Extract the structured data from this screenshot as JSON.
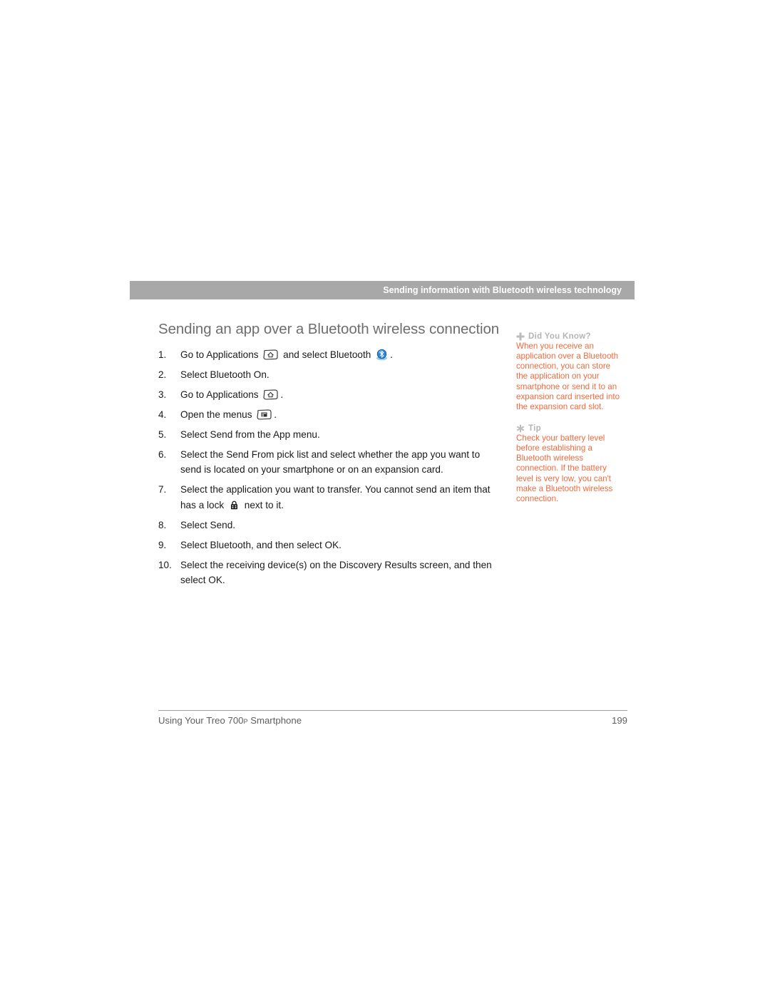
{
  "header": {
    "running_head": "Sending information with Bluetooth wireless technology",
    "banner_color": "#a8a8a8"
  },
  "main": {
    "section_heading": "Sending an app over a Bluetooth wireless connection",
    "steps": [
      {
        "number": "1.",
        "parts": [
          {
            "type": "text",
            "value": "Go to Applications "
          },
          {
            "type": "icon",
            "name": "applications-key-icon"
          },
          {
            "type": "text",
            "value": " and select Bluetooth "
          },
          {
            "type": "icon",
            "name": "bluetooth-icon"
          },
          {
            "type": "text",
            "value": "."
          }
        ],
        "plain": "Go to Applications and select Bluetooth ."
      },
      {
        "number": "2.",
        "parts": [
          {
            "type": "text",
            "value": "Select Bluetooth On."
          }
        ],
        "plain": "Select Bluetooth On."
      },
      {
        "number": "3.",
        "parts": [
          {
            "type": "text",
            "value": "Go to Applications "
          },
          {
            "type": "icon",
            "name": "applications-key-icon"
          },
          {
            "type": "text",
            "value": "."
          }
        ],
        "plain": "Go to Applications ."
      },
      {
        "number": "4.",
        "parts": [
          {
            "type": "text",
            "value": "Open the menus "
          },
          {
            "type": "icon",
            "name": "menu-key-icon"
          },
          {
            "type": "text",
            "value": "."
          }
        ],
        "plain": "Open the menus ."
      },
      {
        "number": "5.",
        "parts": [
          {
            "type": "text",
            "value": "Select Send from the App menu."
          }
        ],
        "plain": "Select Send from the App menu."
      },
      {
        "number": "6.",
        "parts": [
          {
            "type": "text",
            "value": "Select the Send From pick list and select whether the app you want to send is located on your smartphone or on an expansion card."
          }
        ],
        "plain": "Select the Send From pick list and select whether the app you want to send is located on your smartphone or on an expansion card."
      },
      {
        "number": "7.",
        "parts": [
          {
            "type": "text",
            "value": "Select the application you want to transfer. You cannot send an item that has a lock "
          },
          {
            "type": "icon",
            "name": "lock-icon"
          },
          {
            "type": "text",
            "value": " next to it."
          }
        ],
        "plain": "Select the application you want to transfer. You cannot send an item that has a lock next to it."
      },
      {
        "number": "8.",
        "parts": [
          {
            "type": "text",
            "value": "Select Send."
          }
        ],
        "plain": "Select Send."
      },
      {
        "number": "9.",
        "parts": [
          {
            "type": "text",
            "value": "Select Bluetooth, and then select OK."
          }
        ],
        "plain": "Select Bluetooth, and then select OK."
      },
      {
        "number": "10.",
        "parts": [
          {
            "type": "text",
            "value": "Select the receiving device(s) on the Discovery Results screen, and then select OK."
          }
        ],
        "plain": "Select the receiving device(s) on the Discovery Results screen, and then select OK."
      }
    ]
  },
  "sidebar": {
    "accent_color": "#f4693b",
    "label_color": "#b4b4b4",
    "boxes": [
      {
        "icon": "plus-icon",
        "label": "Did You Know?",
        "body": "When you receive an application over a Bluetooth connection, you can store the application on your smartphone or send it to an expansion card inserted into the expansion card slot."
      },
      {
        "icon": "asterisk-icon",
        "label": "Tip",
        "body": "Check your battery level before establishing a Bluetooth wireless connection. If the battery level is very low, you can't make a Bluetooth wireless connection."
      }
    ]
  },
  "footer": {
    "title_main": "Using Your Treo 700",
    "title_sub": "P",
    "title_tail": " Smartphone",
    "page_number": "199"
  }
}
